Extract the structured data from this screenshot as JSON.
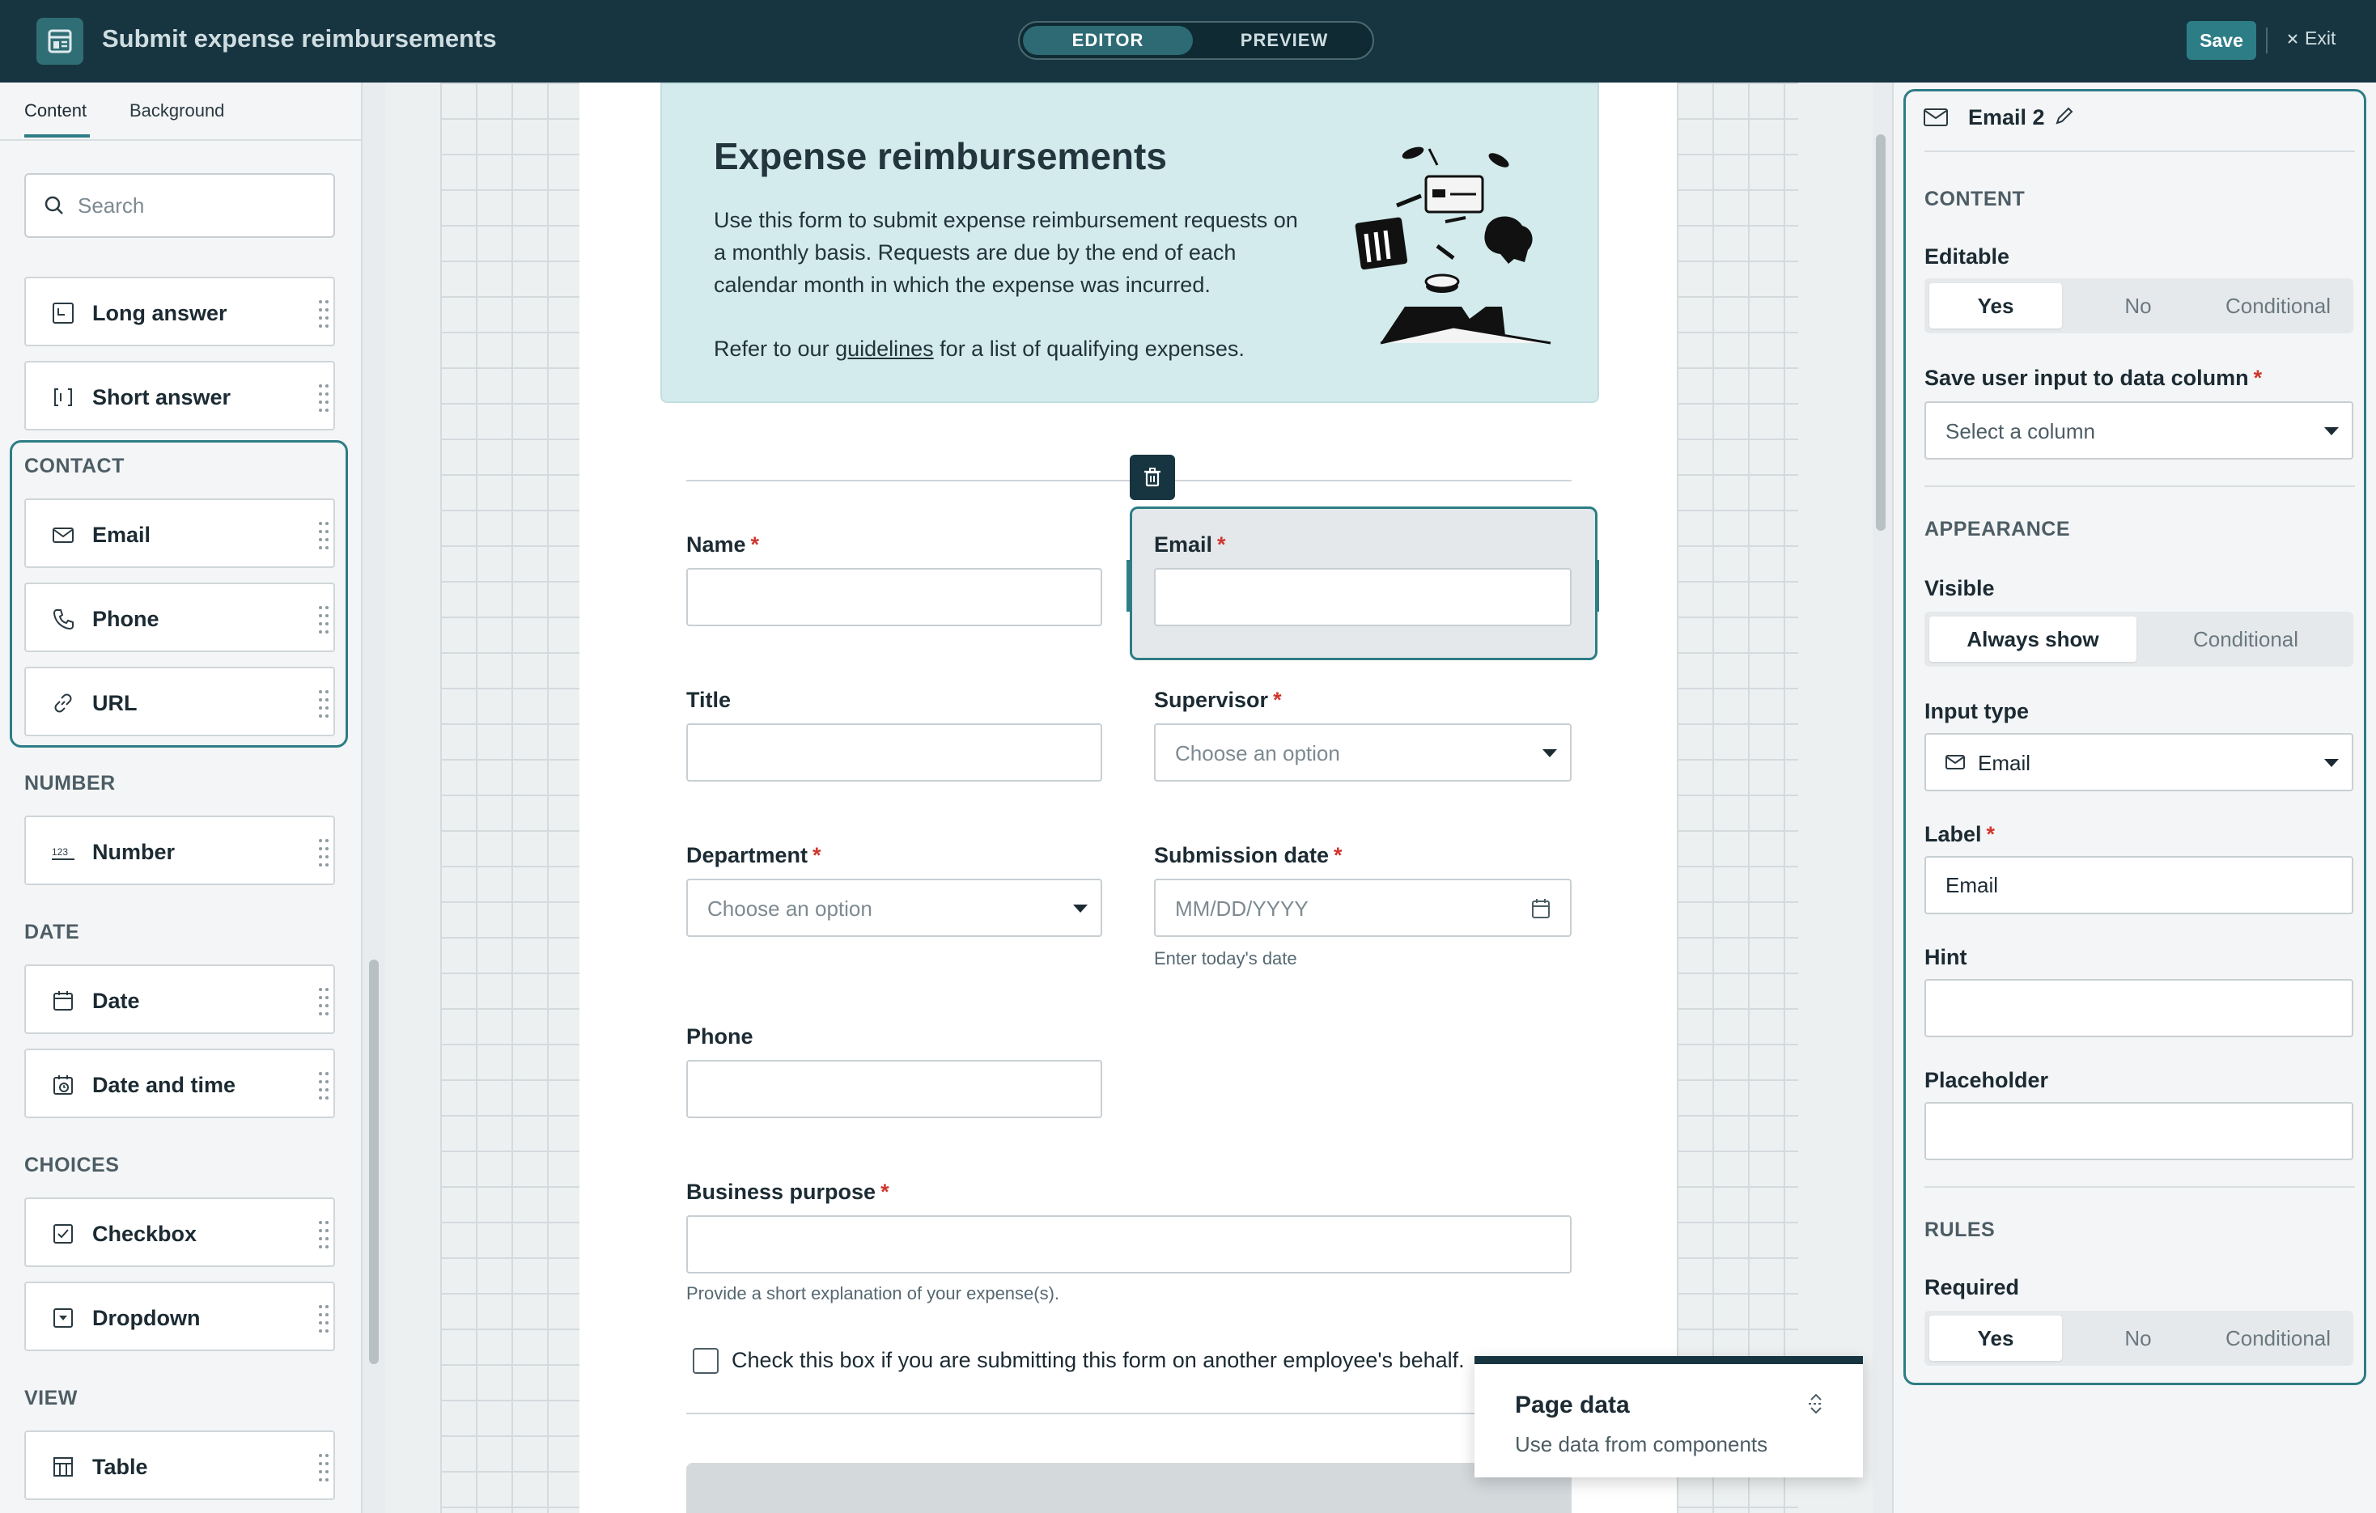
{
  "app": {
    "title": "Submit expense reimbursements",
    "icon": "form-app-icon"
  },
  "mode_toggle": {
    "editor": "EDITOR",
    "preview": "PREVIEW",
    "active": "EDITOR"
  },
  "toolbar": {
    "save_label": "Save",
    "exit_label": "Exit"
  },
  "left_panel": {
    "tabs": [
      "Content",
      "Background"
    ],
    "active_tab": "Content",
    "search_placeholder": "Search",
    "items_top": [
      {
        "label": "Long answer",
        "icon": "long-answer-icon"
      },
      {
        "label": "Short answer",
        "icon": "short-answer-icon"
      }
    ],
    "sections": [
      {
        "title": "CONTACT",
        "items": [
          {
            "label": "Email",
            "icon": "mail-icon"
          },
          {
            "label": "Phone",
            "icon": "phone-icon"
          },
          {
            "label": "URL",
            "icon": "link-icon"
          }
        ]
      },
      {
        "title": "NUMBER",
        "items": [
          {
            "label": "Number",
            "icon": "number-icon"
          }
        ]
      },
      {
        "title": "DATE",
        "items": [
          {
            "label": "Date",
            "icon": "calendar-icon"
          },
          {
            "label": "Date and time",
            "icon": "calendar-clock-icon"
          }
        ]
      },
      {
        "title": "CHOICES",
        "items": [
          {
            "label": "Checkbox",
            "icon": "checkbox-icon"
          },
          {
            "label": "Dropdown",
            "icon": "dropdown-icon"
          }
        ]
      },
      {
        "title": "VIEW",
        "items": [
          {
            "label": "Table",
            "icon": "table-icon"
          }
        ]
      }
    ]
  },
  "form": {
    "hero": {
      "title": "Expense reimbursements",
      "description": "Use this form to submit expense reimbursement requests on a monthly basis. Requests are due by the end of each calendar month in which the expense was incurred.",
      "ref_prefix": "Refer to our ",
      "ref_link": "guidelines",
      "ref_suffix": " for a list of qualifying expenses."
    },
    "fields": {
      "name": {
        "label": "Name",
        "required": "*"
      },
      "email": {
        "label": "Email",
        "required": "*"
      },
      "title": {
        "label": "Title"
      },
      "supervisor": {
        "label": "Supervisor",
        "required": "*",
        "placeholder": "Choose an option"
      },
      "department": {
        "label": "Department",
        "required": "*",
        "placeholder": "Choose an option"
      },
      "submission_date": {
        "label": "Submission date",
        "required": "*",
        "placeholder": "MM/DD/YYYY",
        "hint": "Enter today's date"
      },
      "phone": {
        "label": "Phone"
      },
      "business_purpose": {
        "label": "Business purpose",
        "required": "*",
        "hint": "Provide a short explanation of your expense(s)."
      }
    },
    "checkbox_label": "Check this box if you are submitting this form on another employee's behalf."
  },
  "page_data_panel": {
    "title": "Page data",
    "subtitle": "Use data from components"
  },
  "right_panel": {
    "header": "Email 2",
    "content_section": "CONTENT",
    "editable": {
      "label": "Editable",
      "options": [
        "Yes",
        "No",
        "Conditional"
      ],
      "selected": "Yes"
    },
    "save_column": {
      "label": "Save user input to data column",
      "required": "*",
      "placeholder": "Select a column"
    },
    "appearance_section": "APPEARANCE",
    "visible": {
      "label": "Visible",
      "options": [
        "Always show",
        "Conditional"
      ],
      "selected": "Always show"
    },
    "input_type": {
      "label": "Input type",
      "value": "Email"
    },
    "label_field": {
      "label": "Label",
      "required": "*",
      "value": "Email"
    },
    "hint_field": {
      "label": "Hint",
      "value": ""
    },
    "placeholder_field": {
      "label": "Placeholder",
      "value": ""
    },
    "rules_section": "RULES",
    "required": {
      "label": "Required",
      "options": [
        "Yes",
        "No",
        "Conditional"
      ],
      "selected": "Yes"
    }
  },
  "colors": {
    "topbar": "#173540",
    "accent": "#2d7d86",
    "required": "#d0352c",
    "hero_bg": "#d3ebec"
  }
}
